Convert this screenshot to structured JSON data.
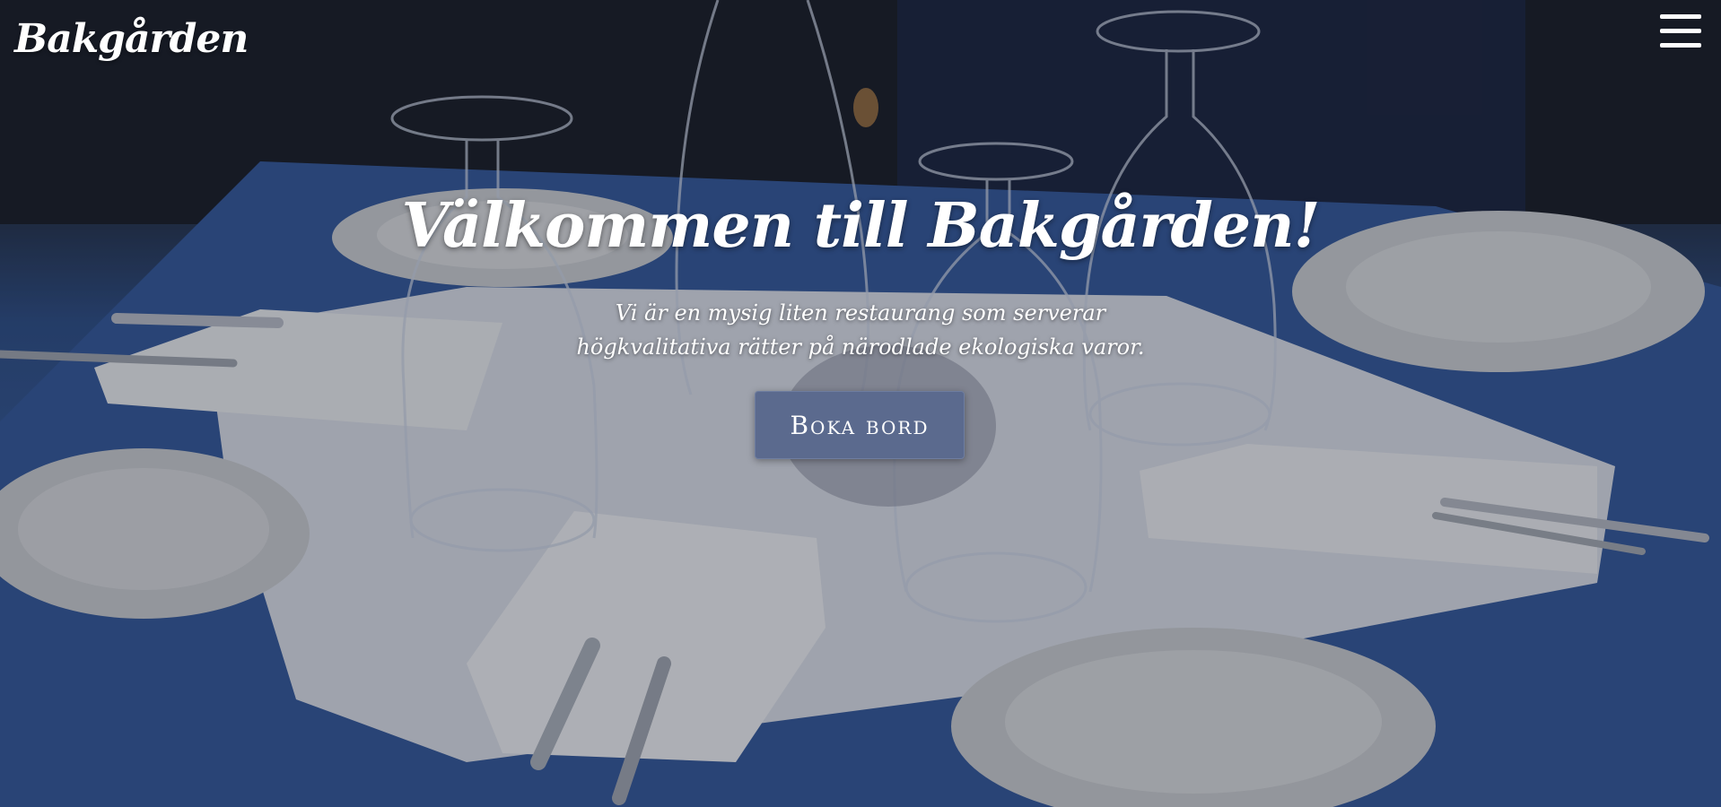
{
  "brand": {
    "logo_text": "Bakgården"
  },
  "header": {
    "menu_icon": "hamburger-menu-icon"
  },
  "hero": {
    "title": "Välkommen till Bakgården!",
    "tagline_line1": "Vi är en mysig liten restaurang som serverar",
    "tagline_line2": "högkvalitativa rätter på närodlade ekologiska varor.",
    "cta_label": "Boka bord",
    "background_image": "restaurant-table-setting"
  },
  "colors": {
    "cta_background": "#5b6a8e",
    "text": "#ffffff",
    "tablecloth": "#3a5f9c"
  }
}
